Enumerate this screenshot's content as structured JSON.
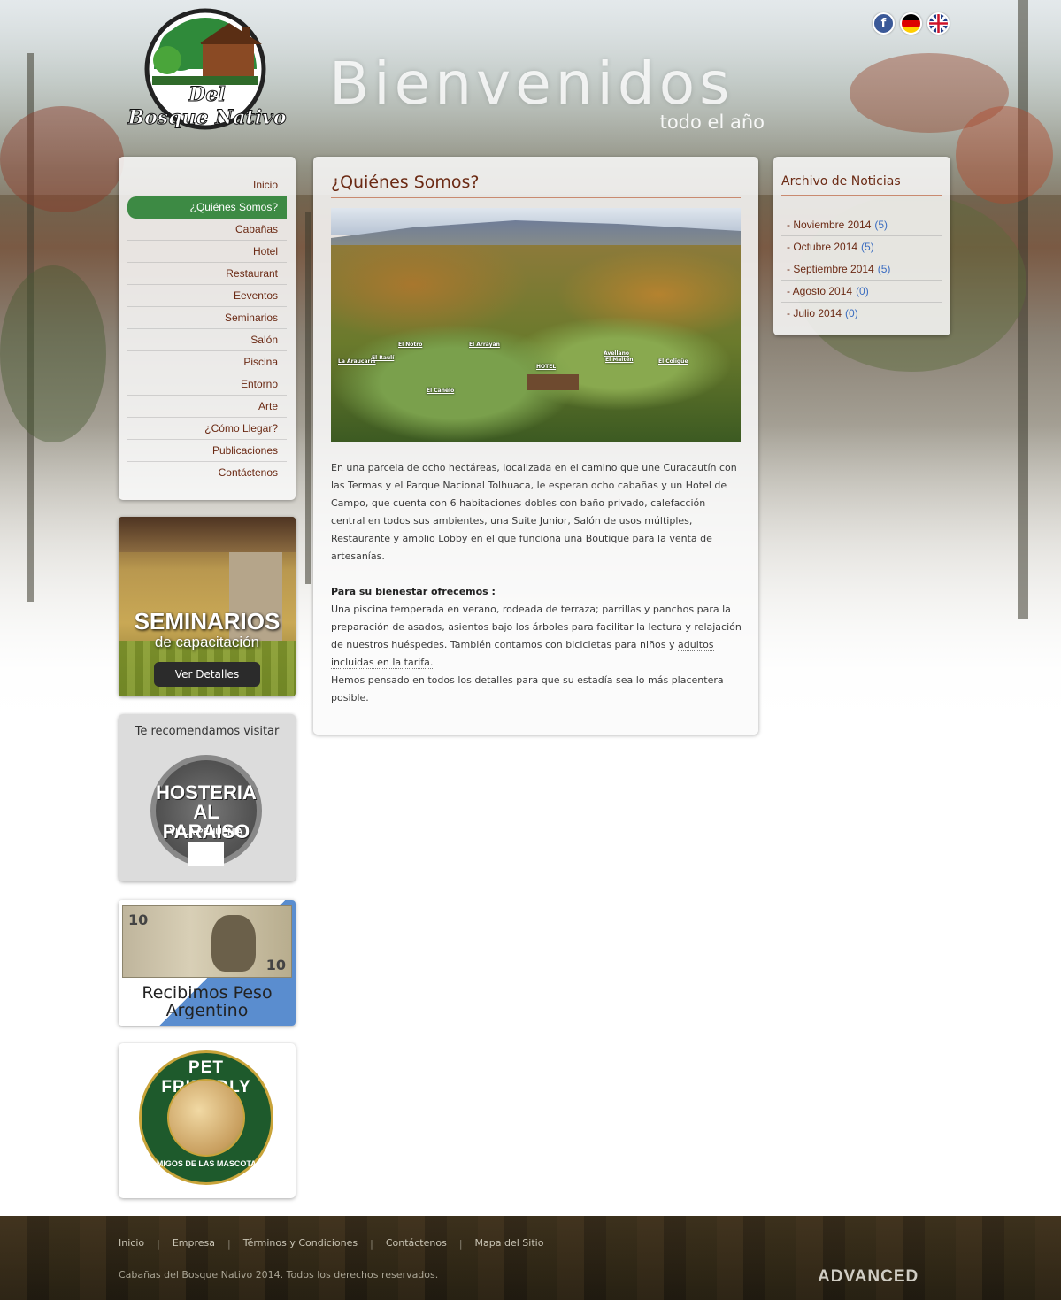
{
  "header": {
    "logo_line1": "Del",
    "logo_line2": "Bosque Nativo",
    "welcome": "Bienvenidos",
    "subtitle": "todo el año",
    "social_icons": [
      "facebook-icon",
      "german-flag-icon",
      "uk-flag-icon"
    ]
  },
  "nav": {
    "items": [
      {
        "label": "Inicio"
      },
      {
        "label": "¿Quiénes Somos?",
        "active": true
      },
      {
        "label": "Cabañas"
      },
      {
        "label": "Hotel"
      },
      {
        "label": "Restaurant"
      },
      {
        "label": "Eeventos"
      },
      {
        "label": "Seminarios"
      },
      {
        "label": "Salón"
      },
      {
        "label": "Piscina"
      },
      {
        "label": "Entorno"
      },
      {
        "label": "Arte"
      },
      {
        "label": "¿Cómo Llegar?"
      },
      {
        "label": "Publicaciones"
      },
      {
        "label": "Contáctenos"
      }
    ]
  },
  "banners": {
    "seminar_title": "SEMINARIOS",
    "seminar_subtitle": "de capacitación",
    "seminar_button": "Ver Detalles",
    "recommend_title": "Te recomendamos visitar",
    "hosteria_line1": "HOSTERIA",
    "hosteria_line2": "AL PARAISO",
    "hosteria_line3": "VILLA PEHUENIA",
    "bill_value": "10",
    "peso_line1": "Recibimos Peso",
    "peso_line2": "Argentino",
    "pet_top": "PET FRIENDLY",
    "pet_bottom": "AMIGOS DE LAS MASCOTAS"
  },
  "main": {
    "title": "¿Quiénes Somos?",
    "photo_labels": [
      "La Araucaria",
      "El Raulí",
      "El Notro",
      "El Arrayán",
      "El Canelo",
      "HOTEL",
      "Avellano",
      "El Maitén",
      "El Coligüe"
    ],
    "para1": "En una parcela de ocho hectáreas, localizada en el camino que une Curacautín con las Termas y el Parque Nacional Tolhuaca, le esperan ocho cabañas y un Hotel de Campo, que cuenta con 6 habitaciones dobles con baño privado, calefacción central en todos sus ambientes, una Suite Junior, Salón de usos múltiples, Restaurante y amplio Lobby en el que funciona una Boutique para la venta de artesanías.",
    "heading2": "Para su bienestar ofrecemos :",
    "para2a": "Una piscina temperada en verano, rodeada de terraza; parrillas y panchos para la preparación de asados, asientos bajo los árboles para facilitar la lectura y relajación de nuestros huéspedes. También contamos con bicicletas para niños y ",
    "para2b": "adultos incluidas en la tarifa.",
    "para3": "Hemos pensado en todos los detalles para que su estadía sea lo más placentera posible."
  },
  "news": {
    "title": "Archivo de Noticias",
    "items": [
      {
        "label": "- Noviembre 2014",
        "count": "(5)"
      },
      {
        "label": "- Octubre 2014",
        "count": "(5)"
      },
      {
        "label": "- Septiembre 2014",
        "count": "(5)"
      },
      {
        "label": "- Agosto 2014",
        "count": "(0)"
      },
      {
        "label": "- Julio 2014",
        "count": "(0)"
      }
    ]
  },
  "footer": {
    "links": [
      "Inicio",
      "Empresa",
      "Términos y Condiciones",
      "Contáctenos",
      "Mapa del Sitio"
    ],
    "copyright": "Cabañas del Bosque Nativo 2014. Todos los derechos reservados.",
    "brand": "ADVANCED"
  },
  "colors": {
    "accent_green": "#3d8a44",
    "link_brown": "#6b2a14",
    "count_blue": "#3a6cc0"
  }
}
